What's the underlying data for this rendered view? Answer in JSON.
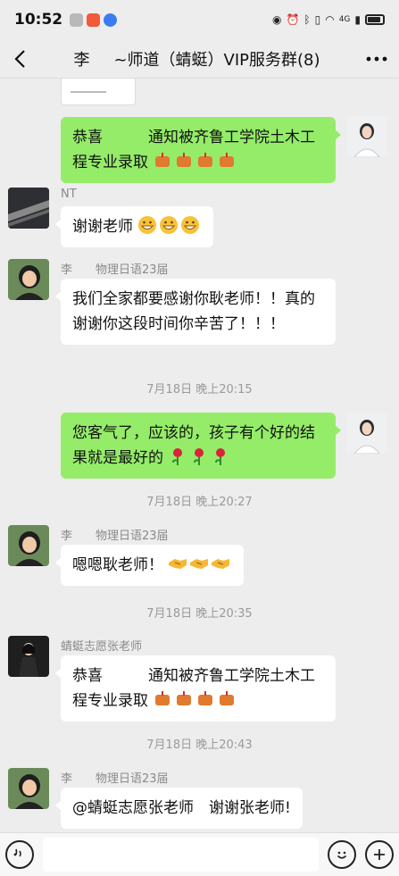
{
  "status_bar": {
    "time": "10:52",
    "network_label": "4G"
  },
  "header": {
    "back_icon": "chevron-left-icon",
    "title": "李   ~师道（蜻蜓）VIP服务群(8)",
    "more_icon": "more-dots-icon"
  },
  "messages": [
    {
      "id": "m1",
      "side": "right",
      "text": "恭喜　　　通知被齐鲁工学院土木工程专业录取",
      "emoji_count": 4
    },
    {
      "id": "m2",
      "side": "left",
      "sender": "NT",
      "text": "谢谢老师",
      "emoji_count": 3
    },
    {
      "id": "m3",
      "side": "left",
      "sender": "李　　物理日语23届",
      "text": "我们全家都要感谢你耿老师！！真的谢谢你这段时间你辛苦了！！！"
    },
    {
      "id": "t1",
      "type": "time",
      "text": "7月18日 晚上20:15"
    },
    {
      "id": "m4",
      "side": "right",
      "text": "您客气了，应该的，孩子有个好的结果就是最好的",
      "emoji_count": 3
    },
    {
      "id": "t2",
      "type": "time",
      "text": "7月18日 晚上20:27"
    },
    {
      "id": "m5",
      "side": "left",
      "sender": "李　　物理日语23届",
      "text": "嗯嗯耿老师！",
      "emoji_count": 3
    },
    {
      "id": "t3",
      "type": "time",
      "text": "7月18日 晚上20:35"
    },
    {
      "id": "m6",
      "side": "left",
      "sender": "蜻蜓志愿张老师",
      "text": "恭喜　　　通知被齐鲁工学院土木工程专业录取",
      "emoji_count": 4
    },
    {
      "id": "t4",
      "type": "time",
      "text": "7月18日 晚上20:43"
    },
    {
      "id": "m7",
      "side": "left",
      "sender": "李　　物理日语23届",
      "text": "@蜻蜓志愿张老师　谢谢张老师!"
    }
  ],
  "input_bar": {
    "voice_icon": "voice-icon",
    "emoji_icon": "emoji-icon",
    "add_icon": "plus-icon",
    "placeholder": ""
  },
  "colors": {
    "background": "#ededed",
    "bubble_self": "#95ec69",
    "bubble_other": "#ffffff",
    "timestamp": "#9a9a9a"
  }
}
